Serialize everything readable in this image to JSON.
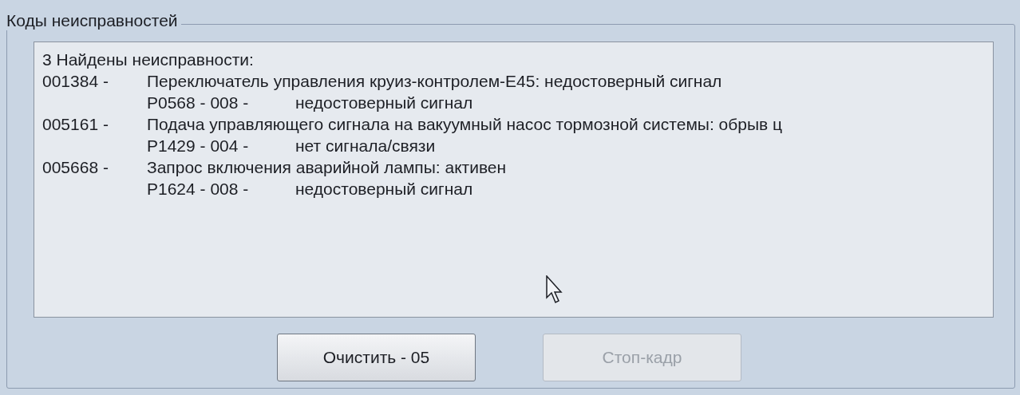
{
  "group": {
    "title": "Коды неисправностей"
  },
  "list": {
    "header": "3 Найдены неисправности:",
    "faults": [
      {
        "code": "001384 -",
        "description": "Переключатель управления круиз-контролем-E45: недостоверный сигнал",
        "detail_code": "P0568 - 008 -",
        "detail": "недостоверный сигнал"
      },
      {
        "code": "005161 -",
        "description": "Подача управляющего сигнала на вакуумный насос тормозной системы: обрыв ц",
        "detail_code": "P1429 - 004 -",
        "detail": "нет сигнала/связи"
      },
      {
        "code": "005668 -",
        "description": "Запрос включения аварийной лампы: активен",
        "detail_code": "P1624 - 008 -",
        "detail": "недостоверный сигнал"
      }
    ]
  },
  "buttons": [
    {
      "label": "Очистить - 05",
      "disabled": false
    },
    {
      "label": "Стоп-кадр",
      "disabled": true
    }
  ]
}
